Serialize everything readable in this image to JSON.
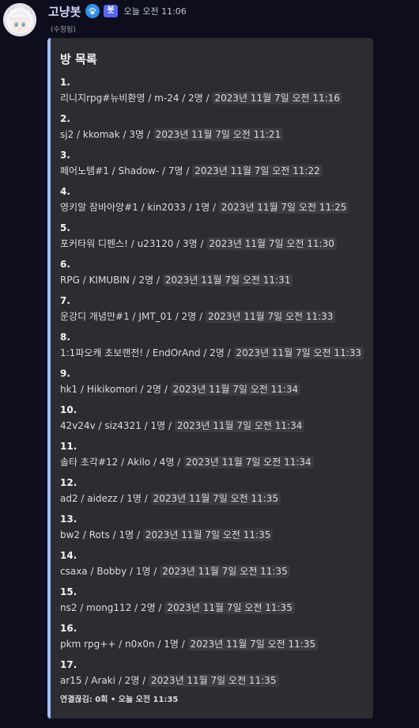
{
  "author": {
    "name": "고냥봇",
    "bot_tag": "봇",
    "timestamp": "오늘 오전 11:06",
    "edited": "(수정됨)"
  },
  "embed": {
    "title": "방 목록",
    "accent_color": "#a5bff8",
    "rooms": [
      {
        "num": "1.",
        "info": "리니지rpg#뉴비환영 / m-24 / 2명 / ",
        "time": "2023년 11월 7일 오전 11:16"
      },
      {
        "num": "2.",
        "info": "sj2 / kkomak / 3명 / ",
        "time": "2023년 11월 7일 오전 11:21"
      },
      {
        "num": "3.",
        "info": "페어노템#1 / Shadow- / 7명 / ",
        "time": "2023년 11월 7일 오전 11:22"
      },
      {
        "num": "4.",
        "info": "영키알 잠바아앙#1 / kin2033 / 1명 / ",
        "time": "2023년 11월 7일 오전 11:25"
      },
      {
        "num": "5.",
        "info": "포커타워 디펜스! / u23120 / 3명 / ",
        "time": "2023년 11월 7일 오전 11:30"
      },
      {
        "num": "6.",
        "info": "RPG / KIMUBIN / 2명 / ",
        "time": "2023년 11월 7일 오전 11:31"
      },
      {
        "num": "7.",
        "info": "운강디 개념만#1 / JMT_01 / 2명 / ",
        "time": "2023년 11월 7일 오전 11:33"
      },
      {
        "num": "8.",
        "info": "1:1파오캐 초보랜전! / EndOrAnd / 2명 / ",
        "time": "2023년 11월 7일 오전 11:33"
      },
      {
        "num": "9.",
        "info": "hk1 / Hikikomori / 2명 / ",
        "time": "2023년 11월 7일 오전 11:34"
      },
      {
        "num": "10.",
        "info": "42v24v / siz4321 / 1명 / ",
        "time": "2023년 11월 7일 오전 11:34"
      },
      {
        "num": "11.",
        "info": "솔타 초각#12 / Akilo / 4명 / ",
        "time": "2023년 11월 7일 오전 11:34"
      },
      {
        "num": "12.",
        "info": "ad2 / aidezz / 1명 / ",
        "time": "2023년 11월 7일 오전 11:35"
      },
      {
        "num": "13.",
        "info": "bw2 / Rots / 1명 / ",
        "time": "2023년 11월 7일 오전 11:35"
      },
      {
        "num": "14.",
        "info": "csaxa / Bobby / 1명 / ",
        "time": "2023년 11월 7일 오전 11:35"
      },
      {
        "num": "15.",
        "info": "ns2 / mong112 / 2명 / ",
        "time": "2023년 11월 7일 오전 11:35"
      },
      {
        "num": "16.",
        "info": "pkm rpg++ / n0x0n / 1명 / ",
        "time": "2023년 11월 7일 오전 11:35"
      },
      {
        "num": "17.",
        "info": "ar15 / Araki / 2명 / ",
        "time": "2023년 11월 7일 오전 11:35"
      }
    ],
    "footer": "연결끊김: 0회 • 오늘 오전 11:35"
  },
  "icons": {
    "avatar": "anime-cat-girl-avatar",
    "badge": "paw-icon"
  }
}
